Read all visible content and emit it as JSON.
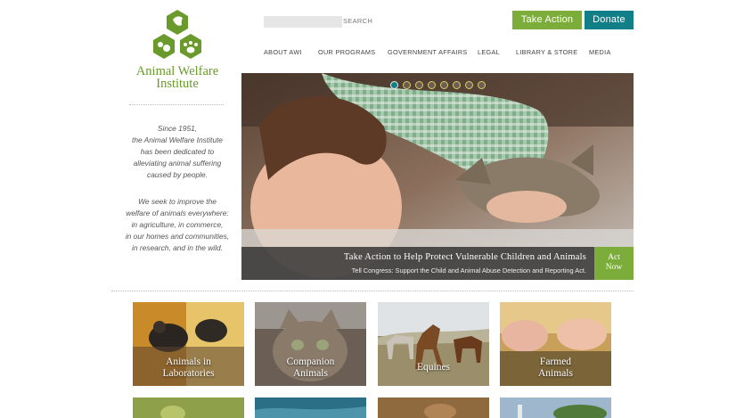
{
  "logo": {
    "line1": "Animal Welfare",
    "line2": "Institute",
    "icon": "awi-hexagon-animals-icon"
  },
  "tagline": {
    "p1": [
      "Since 1951,",
      "the Animal Welfare Institute",
      "has been dedicated to",
      "alleviating animal suffering",
      "caused by people."
    ],
    "p2": [
      "We seek to improve the",
      "welfare of animals everywhere:",
      "in agriculture, in commerce,",
      "in our homes and communities,",
      "in research, and in the wild."
    ]
  },
  "search": {
    "placeholder": "",
    "label": "SEARCH"
  },
  "buttons": {
    "take_action": "Take Action",
    "donate": "Donate"
  },
  "nav": [
    "ABOUT AWI",
    "OUR PROGRAMS",
    "GOVERNMENT AFFAIRS",
    "LEGAL",
    "LIBRARY & STORE",
    "MEDIA"
  ],
  "hero": {
    "title": "Take Action to Help Protect Vulnerable Children and Animals",
    "subtitle": "Tell Congress: Support the Child and Animal Abuse Detection and Reporting Act.",
    "act_now_line1": "Act",
    "act_now_line2": "Now",
    "slide_count": 8,
    "active_slide": 1
  },
  "tiles": [
    {
      "line1": "Animals in",
      "line2": "Laboratories"
    },
    {
      "line1": "Companion",
      "line2": "Animals"
    },
    {
      "line1": "Equines",
      "line2": ""
    },
    {
      "line1": "Farmed",
      "line2": "Animals"
    }
  ],
  "colors": {
    "green": "#7cad3a",
    "teal": "#117f88",
    "logo_green": "#6a9a2c"
  }
}
